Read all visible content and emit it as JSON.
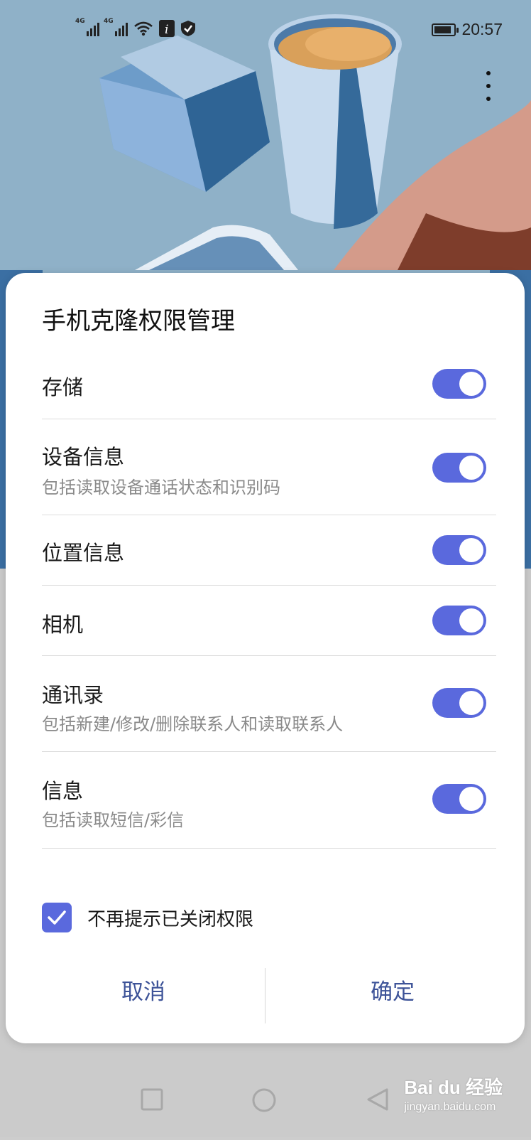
{
  "status_bar": {
    "network_1": "4G",
    "network_2": "4G",
    "time": "20:57",
    "battery_level": 0.9
  },
  "dialog": {
    "title": "手机克隆权限管理",
    "permissions": [
      {
        "name": "存储",
        "desc": "",
        "enabled": true
      },
      {
        "name": "设备信息",
        "desc": "包括读取设备通话状态和识别码",
        "enabled": true
      },
      {
        "name": "位置信息",
        "desc": "",
        "enabled": true
      },
      {
        "name": "相机",
        "desc": "",
        "enabled": true
      },
      {
        "name": "通讯录",
        "desc": "包括新建/修改/删除联系人和读取联系人",
        "enabled": true
      },
      {
        "name": "信息",
        "desc": "包括读取短信/彩信",
        "enabled": true
      }
    ],
    "dont_remind_label": "不再提示已关闭权限",
    "dont_remind_checked": true,
    "cancel_label": "取消",
    "confirm_label": "确定"
  },
  "watermark": {
    "brand": "Bai du 经验",
    "url": "jingyan.baidu.com"
  },
  "colors": {
    "accent": "#5a69dd",
    "button_text": "#3d5398",
    "background_sky": "#8fb1c8"
  },
  "icons": [
    "signal-icon",
    "wifi-icon",
    "info-icon",
    "shield-icon",
    "battery-icon",
    "more-vertical-icon",
    "check-icon",
    "square-nav-icon",
    "circle-nav-icon",
    "back-triangle-icon"
  ]
}
